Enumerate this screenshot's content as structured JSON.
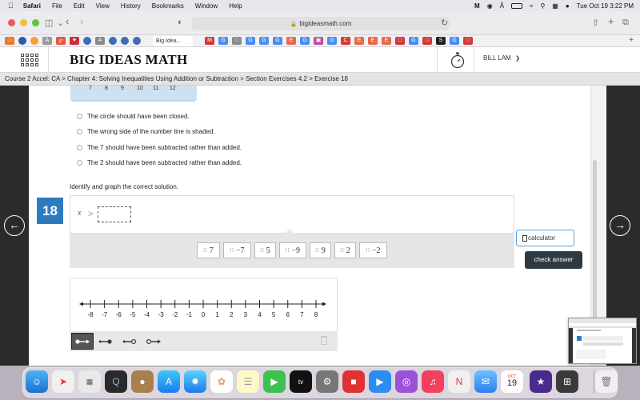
{
  "menubar": {
    "app": "Safari",
    "items": [
      "File",
      "Edit",
      "View",
      "History",
      "Bookmarks",
      "Window",
      "Help"
    ],
    "clock": "Tue Oct 19  3:22 PM"
  },
  "toolbar": {
    "url": "bigideasmath.com"
  },
  "favtab": {
    "label": "Big Idea..."
  },
  "header": {
    "logo": "BIG IDEAS MATH",
    "user": "BILL LAM"
  },
  "breadcrumb": "Course 2 Accel: CA > Chapter 4: Solving Inequalities Using Addition or Subtraction > Section Exercises 4.2 > Exercise 18",
  "prev_image": {
    "ticks": [
      "7",
      "8",
      "9",
      "10",
      "11",
      "12"
    ]
  },
  "choices": [
    "The circle should have been closed.",
    "The wrong side of the number line is shaded.",
    "The 7 should have been subtracted rather than added.",
    "The 2 should have been subtracted rather than added."
  ],
  "question": {
    "prompt": "Identify and graph the correct solution.",
    "number": "18",
    "variable": "x",
    "symbol": ">"
  },
  "tiles": [
    "7",
    "−7",
    "5",
    "−9",
    "9",
    "2",
    "−2"
  ],
  "buttons": {
    "calculator": "calculator",
    "check": "check answer"
  },
  "number_line": {
    "labels": [
      "-8",
      "-7",
      "-6",
      "-5",
      "-4",
      "-3",
      "-2",
      "-1",
      "0",
      "1",
      "2",
      "3",
      "4",
      "5",
      "6",
      "7",
      "8"
    ]
  },
  "dock": {
    "calendar_month": "OCT",
    "calendar_day": "19"
  }
}
